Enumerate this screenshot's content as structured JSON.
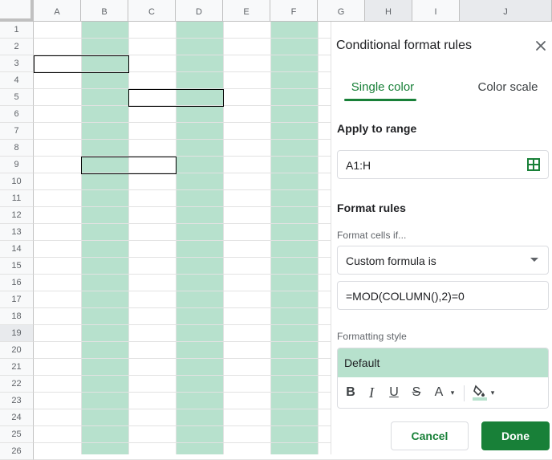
{
  "sheet": {
    "columns": [
      "A",
      "B",
      "C",
      "D",
      "E",
      "F",
      "G",
      "H",
      "I",
      "J"
    ],
    "selected_column": "H",
    "rows": [
      "1",
      "2",
      "3",
      "4",
      "5",
      "6",
      "7",
      "8",
      "9",
      "10",
      "11",
      "12",
      "13",
      "14",
      "15",
      "16",
      "17",
      "18",
      "19",
      "20",
      "21",
      "22",
      "23",
      "24",
      "25",
      "26"
    ],
    "highlight_color": "#b7e1cd"
  },
  "panel": {
    "title": "Conditional format rules",
    "close_icon": "close-icon",
    "tabs": [
      "Single color",
      "Color scale"
    ],
    "active_tab": "Single color",
    "apply_to_range_label": "Apply to range",
    "range_value": "A1:H",
    "range_icon": "grid-select-icon",
    "format_rules_label": "Format rules",
    "format_cells_if_label": "Format cells if...",
    "condition_value": "Custom formula is",
    "formula_value": "=MOD(COLUMN(),2)=0",
    "formatting_style_label": "Formatting style",
    "style_preview_text": "Default",
    "toolbar": {
      "bold": "B",
      "italic": "I",
      "underline": "U",
      "strikethrough": "S",
      "text_color": "A",
      "fill_icon": "fill-color-icon"
    },
    "cancel_label": "Cancel",
    "done_label": "Done",
    "accent_color": "#188038"
  }
}
